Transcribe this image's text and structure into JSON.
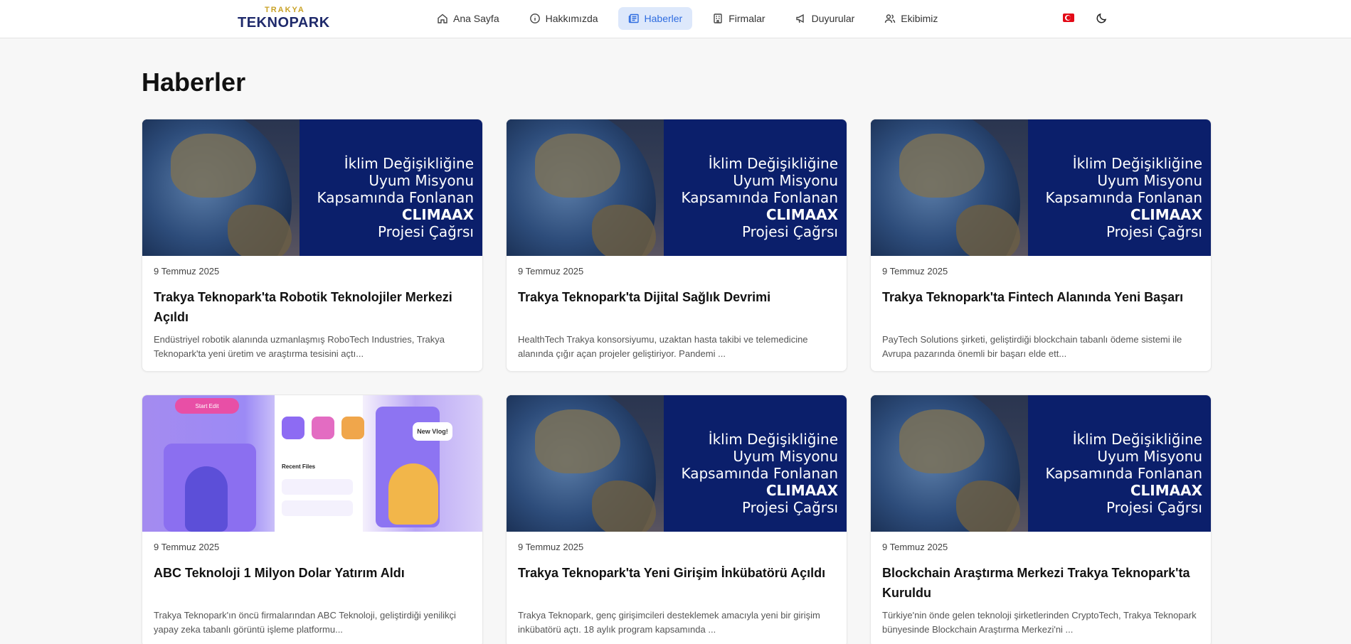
{
  "navbar": {
    "logo_top": "TRAKYA",
    "logo_main": "TEKNOPARK",
    "items": [
      {
        "label": "Ana Sayfa",
        "icon": "home-icon"
      },
      {
        "label": "Hakkımızda",
        "icon": "info-icon"
      },
      {
        "label": "Haberler",
        "icon": "newspaper-icon",
        "active": true
      },
      {
        "label": "Firmalar",
        "icon": "building-icon"
      },
      {
        "label": "Duyurular",
        "icon": "megaphone-icon"
      },
      {
        "label": "Ekibimiz",
        "icon": "users-icon"
      }
    ],
    "language_icon": "turkey-flag-icon",
    "theme_icon": "moon-icon",
    "active_color": "#2f6de0"
  },
  "page": {
    "title": "Haberler"
  },
  "banner_climate": {
    "line1": "İklim Değişikliğine",
    "line2": "Uyum Misyonu",
    "line3": "Kapsamında Fonlanan",
    "line4": "CLIMAAX",
    "line5": "Projesi Çağrsı"
  },
  "banner_app": {
    "start_label": "Start Edit",
    "section_label": "Recent Files",
    "bubble_label": "New Vlog!"
  },
  "news": [
    {
      "date": "9 Temmuz 2025",
      "title": "Trakya Teknopark'ta Robotik Teknolojiler Merkezi Açıldı",
      "excerpt": "Endüstriyel robotik alanında uzmanlaşmış RoboTech Industries, Trakya Teknopark'ta yeni üretim ve araştırma tesisini açtı...",
      "image": "climate"
    },
    {
      "date": "9 Temmuz 2025",
      "title": "Trakya Teknopark'ta Dijital Sağlık Devrimi",
      "excerpt": "HealthTech Trakya konsorsiyumu, uzaktan hasta takibi ve telemedicine alanında çığır açan projeler geliştiriyor. Pandemi ...",
      "image": "climate"
    },
    {
      "date": "9 Temmuz 2025",
      "title": "Trakya Teknopark'ta Fintech Alanında Yeni Başarı",
      "excerpt": "PayTech Solutions şirketi, geliştirdiği blockchain tabanlı ödeme sistemi ile Avrupa pazarında önemli bir başarı elde ett...",
      "image": "climate"
    },
    {
      "date": "9 Temmuz 2025",
      "title": "ABC Teknoloji 1 Milyon Dolar Yatırım Aldı",
      "excerpt": "Trakya Teknopark'ın öncü firmalarından ABC Teknoloji, geliştirdiği yenilikçi yapay zeka tabanlı görüntü işleme platformu...",
      "image": "app"
    },
    {
      "date": "9 Temmuz 2025",
      "title": "Trakya Teknopark'ta Yeni Girişim İnkübatörü Açıldı",
      "excerpt": "Trakya Teknopark, genç girişimcileri desteklemek amacıyla yeni bir girişim inkübatörü açtı. 18 aylık program kapsamında ...",
      "image": "climate"
    },
    {
      "date": "9 Temmuz 2025",
      "title": "Blockchain Araştırma Merkezi Trakya Teknopark'ta Kuruldu",
      "excerpt": "Türkiye'nin önde gelen teknoloji şirketlerinden CryptoTech, Trakya Teknopark bünyesinde Blockchain Araştırma Merkezi'ni ...",
      "image": "climate"
    }
  ]
}
